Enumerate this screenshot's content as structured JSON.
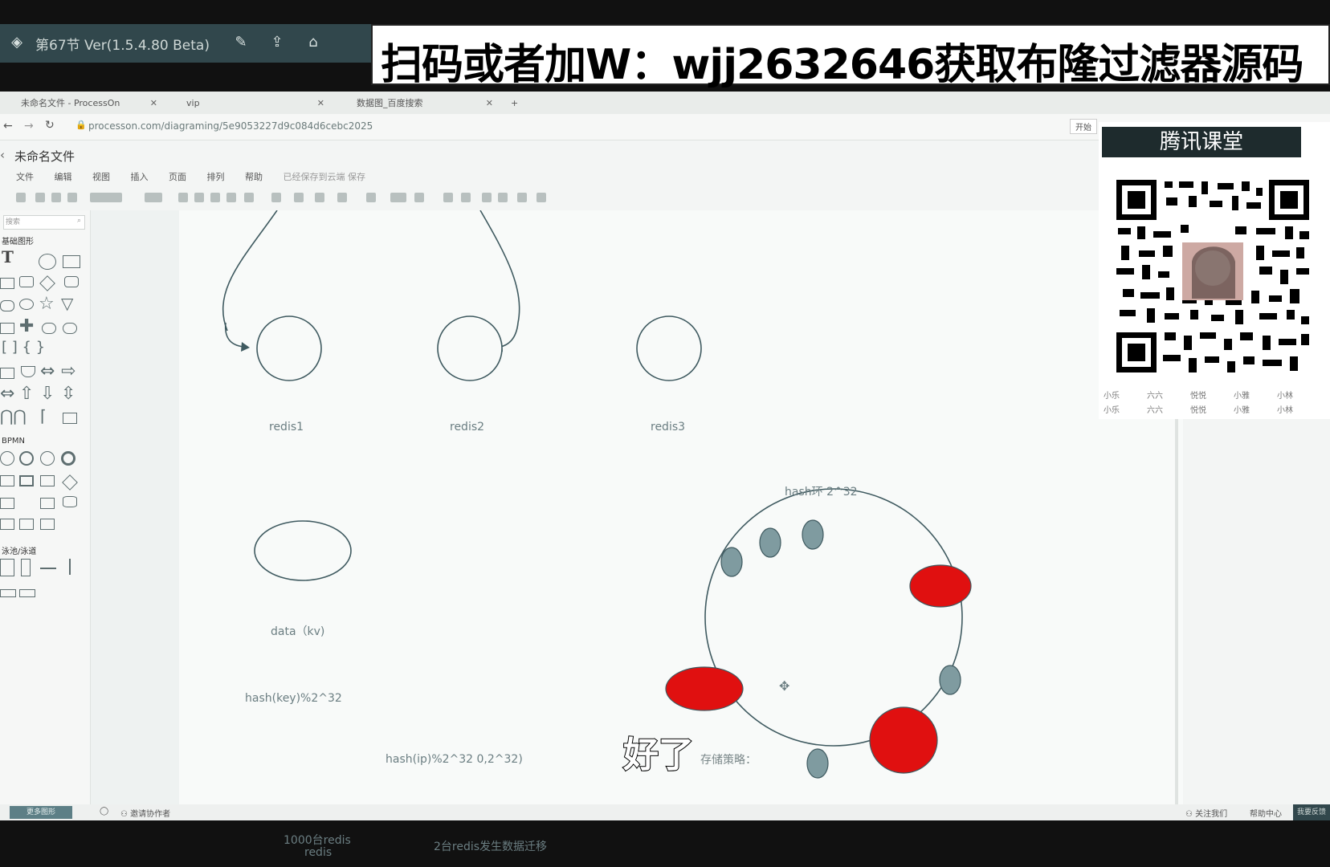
{
  "player": {
    "title": "第67节 Ver(1.5.4.80 Beta)"
  },
  "banner": {
    "text": "扫码或者加W：wjj2632646获取布隆过滤器源码"
  },
  "browser": {
    "tabs": [
      {
        "label": "未命名文件 - ProcessOn"
      },
      {
        "label": "vip"
      },
      {
        "label": "数据图_百度搜索"
      }
    ],
    "url": "processon.com/diagraming/5e9053227d9c084d6cebc2025",
    "right_button": "开始"
  },
  "editor": {
    "file_title": "未命名文件",
    "menus": [
      "文件",
      "编辑",
      "视图",
      "插入",
      "页面",
      "排列",
      "帮助"
    ],
    "save_status": "已经保存到云端 保存",
    "search_placeholder": "搜索",
    "sections": [
      "基础图形",
      "BPMN",
      "泳池/泳道"
    ],
    "status_left": "更多图形",
    "status_invite": "邀请协作者",
    "status_follow": "关注我们",
    "status_help": "帮助中心",
    "status_feedback": "我要反馈"
  },
  "diagram": {
    "nodes": [
      "redis1",
      "redis2",
      "redis3"
    ],
    "data_node": "data（kv)",
    "hash_ring_label": "hash环 2^32",
    "hash_key": "hash(key)%2^32",
    "hash_ip": "hash(ip)%2^32  0,2^32)",
    "note_1000_line1": "1000台redis",
    "note_1000_line2": "redis",
    "note_migration": "2台redis发生数据迁移",
    "strategy": "存储策略："
  },
  "overlay": {
    "brand": "腾讯课堂",
    "bottom_row1": [
      "小乐",
      "六六",
      "悦悦",
      "小雅",
      "小林"
    ],
    "bottom_row2": [
      "小乐",
      "六六",
      "悦悦",
      "小雅",
      "小林"
    ]
  },
  "subtitle": "好了",
  "colors": {
    "player_bar": "#31474c",
    "red_node": "#e01010",
    "gray_node": "#7f9ba0",
    "line": "#3f5a60"
  }
}
